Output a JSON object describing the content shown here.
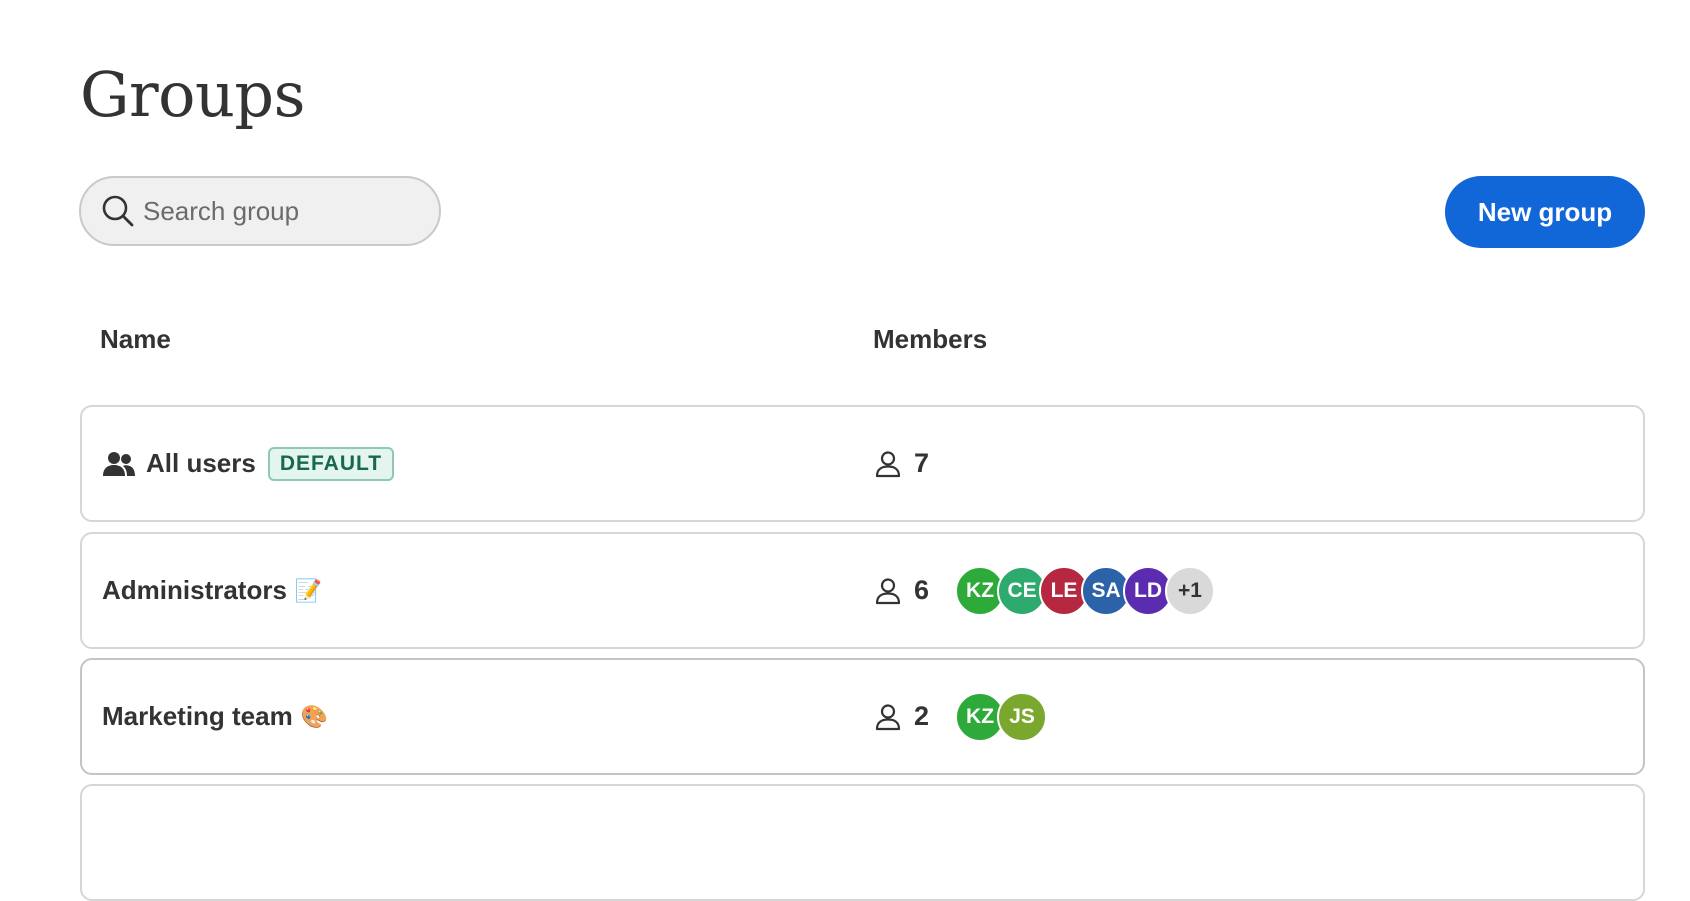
{
  "page": {
    "title": "Groups"
  },
  "search": {
    "placeholder": "Search group",
    "value": ""
  },
  "toolbar": {
    "new_group_label": "New group"
  },
  "table": {
    "headers": {
      "name": "Name",
      "members": "Members"
    },
    "rows": [
      {
        "name": "All users",
        "icon": "users-icon",
        "badge": "DEFAULT",
        "emoji": "",
        "member_count": "7",
        "avatars": []
      },
      {
        "name": "Administrators",
        "emoji": "📝",
        "member_count": "6",
        "avatars": [
          {
            "initials": "KZ",
            "color": "#2eaa3a"
          },
          {
            "initials": "CE",
            "color": "#2eaa6e"
          },
          {
            "initials": "LE",
            "color": "#b5283f"
          },
          {
            "initials": "SA",
            "color": "#2b62a8"
          },
          {
            "initials": "LD",
            "color": "#5b2bb0"
          }
        ],
        "more": "+1"
      },
      {
        "name": "Marketing team",
        "emoji": "🎨",
        "member_count": "2",
        "avatars": [
          {
            "initials": "KZ",
            "color": "#2eaa3a"
          },
          {
            "initials": "JS",
            "color": "#7aa82e"
          }
        ]
      }
    ]
  },
  "colors": {
    "accent": "#1166d8",
    "badge_text": "#17684c",
    "badge_bg": "#e3f5ee"
  }
}
